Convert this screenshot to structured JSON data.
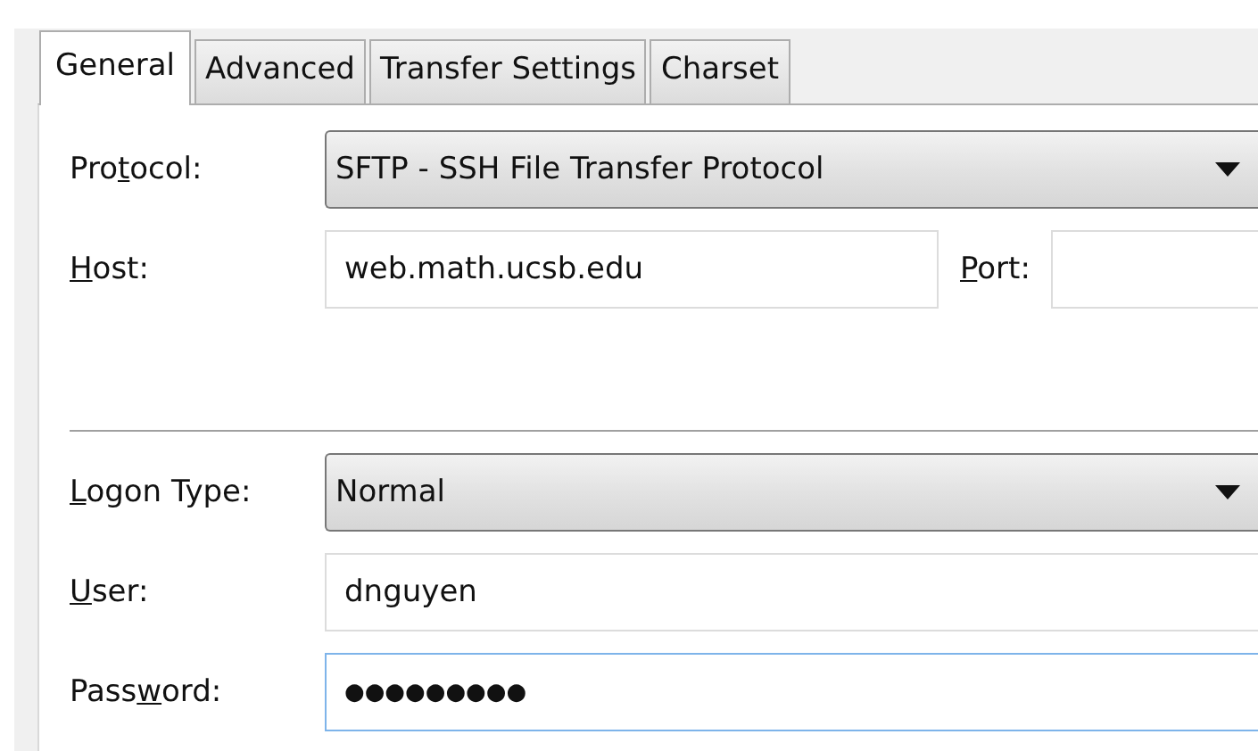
{
  "tabs": [
    {
      "label": "General",
      "selected": true
    },
    {
      "label": "Advanced",
      "selected": false
    },
    {
      "label": "Transfer Settings",
      "selected": false
    },
    {
      "label": "Charset",
      "selected": false
    }
  ],
  "protocol": {
    "label": {
      "before": "Pro",
      "key": "t",
      "after": "ocol:"
    },
    "value": "SFTP - SSH File Transfer Protocol"
  },
  "host": {
    "label": {
      "key": "H",
      "after": "ost:"
    },
    "value": "web.math.ucsb.edu"
  },
  "port": {
    "label": {
      "key": "P",
      "after": "ort:"
    }
  },
  "logon_type": {
    "label": {
      "key": "L",
      "after": "ogon Type:"
    },
    "value": "Normal"
  },
  "user": {
    "label": {
      "key": "U",
      "after": "ser:"
    },
    "value": "dnguyen"
  },
  "password": {
    "label": {
      "before": "Pass",
      "key": "w",
      "after": "ord:"
    },
    "value": "●●●●●●●●●",
    "focused": true
  }
}
